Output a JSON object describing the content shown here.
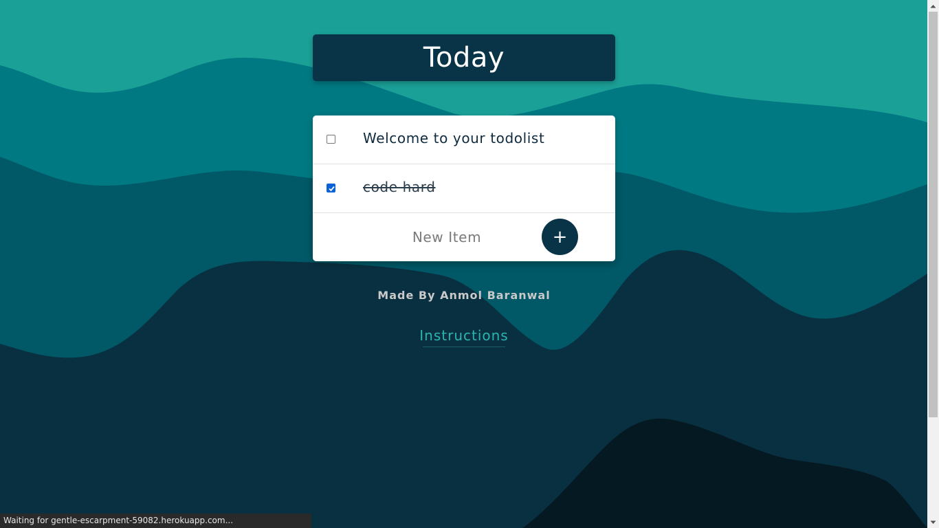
{
  "page": {
    "title": "Today"
  },
  "todo": {
    "items": [
      {
        "label": "Welcome to your todolist",
        "checked": false
      },
      {
        "label": "code hard",
        "checked": true
      }
    ],
    "new_item_placeholder": "New Item",
    "add_button_label": "+"
  },
  "footer": {
    "made_by": "Made By Anmol Baranwal",
    "instructions_link": "Instructions"
  },
  "browser": {
    "status_text": "Waiting for gentle-escarpment-59082.herokuapp.com..."
  },
  "colors": {
    "wave_top": "#1ba098",
    "wave_mid": "#007982",
    "wave_deep": "#015866",
    "wave_dark": "#093041",
    "wave_darkest": "#051923",
    "header_bg": "#093447",
    "accent_link": "#2bb5b0",
    "checkbox_checked": "#0b62d6"
  },
  "icons": {
    "add": "plus-icon",
    "scroll_up": "chevron-up-icon",
    "scroll_down": "chevron-down-icon"
  }
}
